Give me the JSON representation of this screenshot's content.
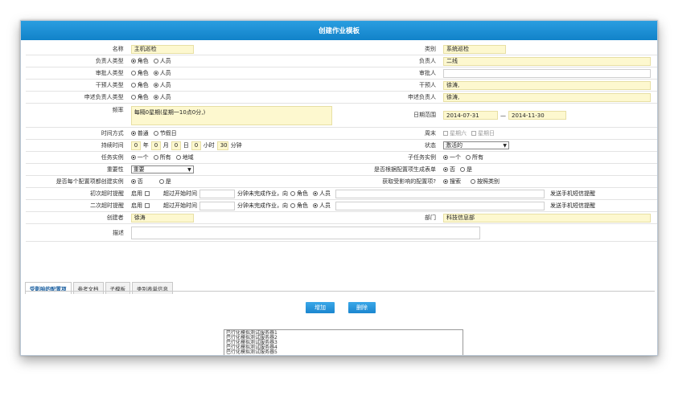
{
  "window": {
    "title": "创建作业模板"
  },
  "rows": {
    "name": {
      "label": "名称",
      "value": "主机巡检"
    },
    "category": {
      "label": "类别",
      "value": "系统巡检"
    },
    "owner_type": {
      "label": "负责人类型",
      "opt1": "角色",
      "opt2": "人员",
      "selected": 1
    },
    "owner": {
      "label": "负责人",
      "value": "二线"
    },
    "approver_type": {
      "label": "审批人类型",
      "opt1": "角色",
      "opt2": "人员",
      "selected": 2
    },
    "approver": {
      "label": "审批人",
      "value": ""
    },
    "intervener_type": {
      "label": "干预人类型",
      "opt1": "角色",
      "opt2": "人员",
      "selected": 2
    },
    "intervener": {
      "label": "干预人",
      "value": "徐涛,"
    },
    "appeal_owner_type": {
      "label": "申述负责人类型",
      "opt1": "角色",
      "opt2": "人员",
      "selected": 2
    },
    "appeal_owner": {
      "label": "申述负责人",
      "value": "徐涛,"
    },
    "frequency": {
      "label": "频率",
      "value": "每隔0星期(星期一10点0分,)"
    },
    "date_range": {
      "label": "日期范围",
      "start": "2014-07-31",
      "sep": "—",
      "end": "2014-11-30"
    },
    "time_mode": {
      "label": "时间方式",
      "opt1": "普通",
      "opt2": "节假日",
      "selected": 1
    },
    "weekend": {
      "label": "周末",
      "opt1": "星期六",
      "opt2": "星期日"
    },
    "duration": {
      "label": "持续时间",
      "y": "0",
      "y_unit": "年",
      "m": "0",
      "m_unit": "月",
      "d": "0",
      "d_unit": "日",
      "h": "0",
      "h_unit": "小时",
      "min": "30",
      "min_unit": "分钟"
    },
    "status": {
      "label": "状态",
      "value": "激活的"
    },
    "task_instance": {
      "label": "任务实例",
      "opt1": "一个",
      "opt2": "所有",
      "opt3": "地域",
      "selected": 1
    },
    "subtask_instance": {
      "label": "子任务实例",
      "opt1": "一个",
      "opt2": "所有",
      "selected": 1
    },
    "importance": {
      "label": "重要性",
      "value": "重要"
    },
    "gen_form": {
      "label": "是否根据配置项生成表单",
      "opt1": "否",
      "opt2": "是",
      "selected": 1
    },
    "per_config": {
      "label": "是否每个配置项都创建实例",
      "opt1": "否",
      "opt2": "是",
      "selected": 1
    },
    "get_config": {
      "label": "获取受影响的配置项?",
      "opt1": "搜索",
      "opt2": "按照类别",
      "selected": 1
    },
    "first_timeout": {
      "label": "初次超时提醒",
      "enable": "启用",
      "over_start": "超过开始时间",
      "suffix": "分钟未完成作业，向",
      "opt1": "角色",
      "opt2": "人员",
      "selected": 2,
      "sms": "发送手机短信提醒"
    },
    "second_timeout": {
      "label": "二次超时提醒",
      "enable": "启用",
      "over_start": "超过开始时间",
      "suffix": "分钟未完成作业，向",
      "opt1": "角色",
      "opt2": "人员",
      "selected": 2,
      "sms": "发送手机短信提醒"
    },
    "creator": {
      "label": "创建者",
      "value": "徐涛"
    },
    "department": {
      "label": "部门",
      "value": "科技信息部"
    },
    "description": {
      "label": "描述",
      "value": ""
    }
  },
  "tabs": [
    "受影响的配置项",
    "参考文档",
    "子模板",
    "类别表单信息"
  ],
  "buttons": {
    "add": "增加",
    "delete": "删除"
  },
  "list_items": [
    "巴行化模拟测试服务器1",
    "巴行化模拟测试服务器2",
    "巴行化模拟测试服务器3",
    "巴行化模拟测试服务器4",
    "巴行化模拟测试服务器5"
  ],
  "colors": {
    "title_bar": "#1182c9",
    "field_bg": "#fdf8cf"
  }
}
